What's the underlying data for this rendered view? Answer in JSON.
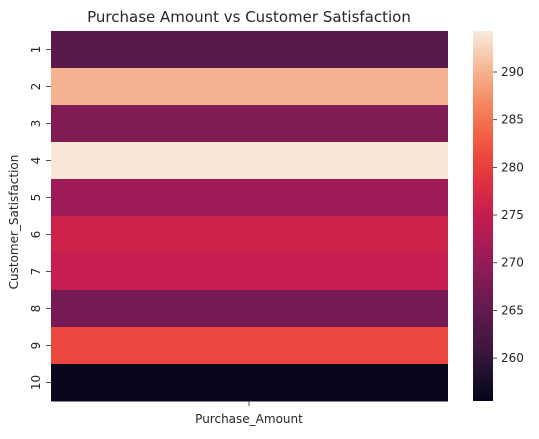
{
  "chart_data": {
    "type": "heatmap",
    "title": "Purchase Amount vs Customer Satisfaction",
    "xlabel": "Purchase_Amount",
    "ylabel": "Customer_Satisfaction",
    "x_categories": [],
    "y_categories": [
      "1",
      "2",
      "3",
      "4",
      "5",
      "6",
      "7",
      "8",
      "9",
      "10"
    ],
    "values": [
      264,
      290,
      268,
      294,
      271,
      276,
      275,
      267,
      281,
      256
    ],
    "colorbar": {
      "vmin": 255.5,
      "vmax": 294.3,
      "ticks": [
        260,
        265,
        270,
        275,
        280,
        285,
        290
      ],
      "colormap": "rocket"
    },
    "grid": false,
    "legend": "colorbar-right"
  }
}
